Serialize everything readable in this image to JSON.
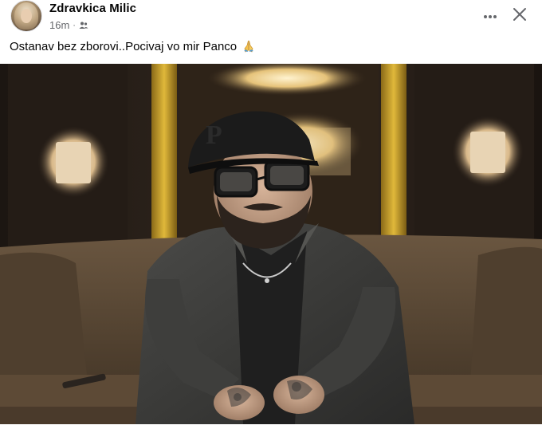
{
  "post": {
    "author_name": "Zdravkica Milic",
    "timestamp": "16m",
    "separator": "·",
    "audience_icon": "friends-icon",
    "caption": "Ostanav bez zborovi..Pocivaj vo mir Panco",
    "caption_emoji": "folded-hands-icon",
    "more_icon": "more-options-icon",
    "close_icon": "close-icon"
  },
  "colors": {
    "primary_text": "#050505",
    "secondary_text": "#65676b",
    "background": "#ffffff"
  },
  "photo": {
    "subject": "man-in-cap-and-glasses-seated-on-sofa"
  }
}
